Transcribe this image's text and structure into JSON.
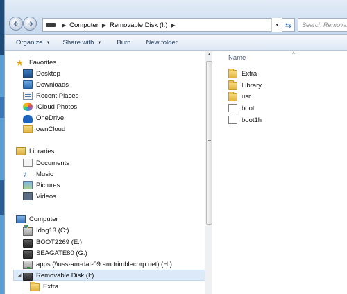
{
  "address": {
    "crumbs": [
      "Computer",
      "Removable Disk (I:)"
    ],
    "search_placeholder": "Search Removable Disk (I:)"
  },
  "toolbar": {
    "organize": "Organize",
    "share_with": "Share with",
    "burn": "Burn",
    "new_folder": "New folder"
  },
  "nav": {
    "favorites": {
      "label": "Favorites",
      "items": [
        "Desktop",
        "Downloads",
        "Recent Places",
        "iCloud Photos",
        "OneDrive",
        "ownCloud"
      ]
    },
    "libraries": {
      "label": "Libraries",
      "items": [
        "Documents",
        "Music",
        "Pictures",
        "Videos"
      ]
    },
    "computer": {
      "label": "Computer",
      "items": [
        "Idog13 (C:)",
        "BOOT2269 (E:)",
        "SEAGATE80 (G:)",
        "apps (\\\\uss-am-dat-09.am.trimblecorp.net) (H:)",
        "Removable Disk (I:)",
        "Extra"
      ]
    }
  },
  "content": {
    "column_name": "Name",
    "files": [
      {
        "name": "Extra",
        "icon": "folder-icon"
      },
      {
        "name": "Library",
        "icon": "folder-icon"
      },
      {
        "name": "usr",
        "icon": "folder-icon"
      },
      {
        "name": "boot",
        "icon": "file-icon"
      },
      {
        "name": "boot1h",
        "icon": "file-icon"
      }
    ]
  }
}
